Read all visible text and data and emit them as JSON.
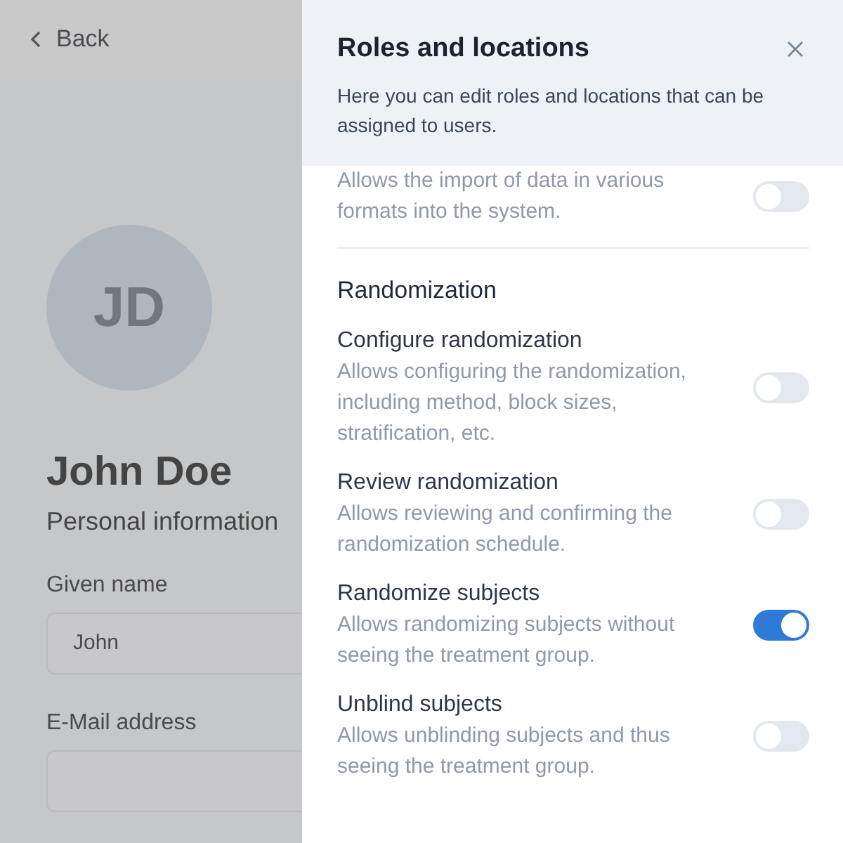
{
  "background": {
    "back_link": "Back",
    "avatar_initials": "JD",
    "name": "John Doe",
    "subtitle": "Personal information",
    "fields": [
      {
        "label": "Given name",
        "value": "John"
      },
      {
        "label": "E-Mail address"
      }
    ]
  },
  "panel": {
    "title": "Roles and locations",
    "description": "Here you can edit roles and locations that can be assigned to users.",
    "sections": [
      {
        "items": [
          {
            "description": "Allows the import of data in various formats into the system.",
            "on": false
          }
        ]
      },
      {
        "title": "Randomization",
        "items": [
          {
            "title": "Configure randomization",
            "description": "Allows configuring the randomization, including method, block sizes, stratification, etc.",
            "on": false
          },
          {
            "title": "Review randomization",
            "description": "Allows reviewing and confirming the randomization schedule.",
            "on": false
          },
          {
            "title": "Randomize subjects",
            "description": "Allows randomizing subjects without seeing the treatment group.",
            "on": true
          },
          {
            "title": "Unblind subjects",
            "description": "Allows unblinding subjects and thus seeing the treatment group.",
            "on": false
          }
        ]
      }
    ]
  }
}
